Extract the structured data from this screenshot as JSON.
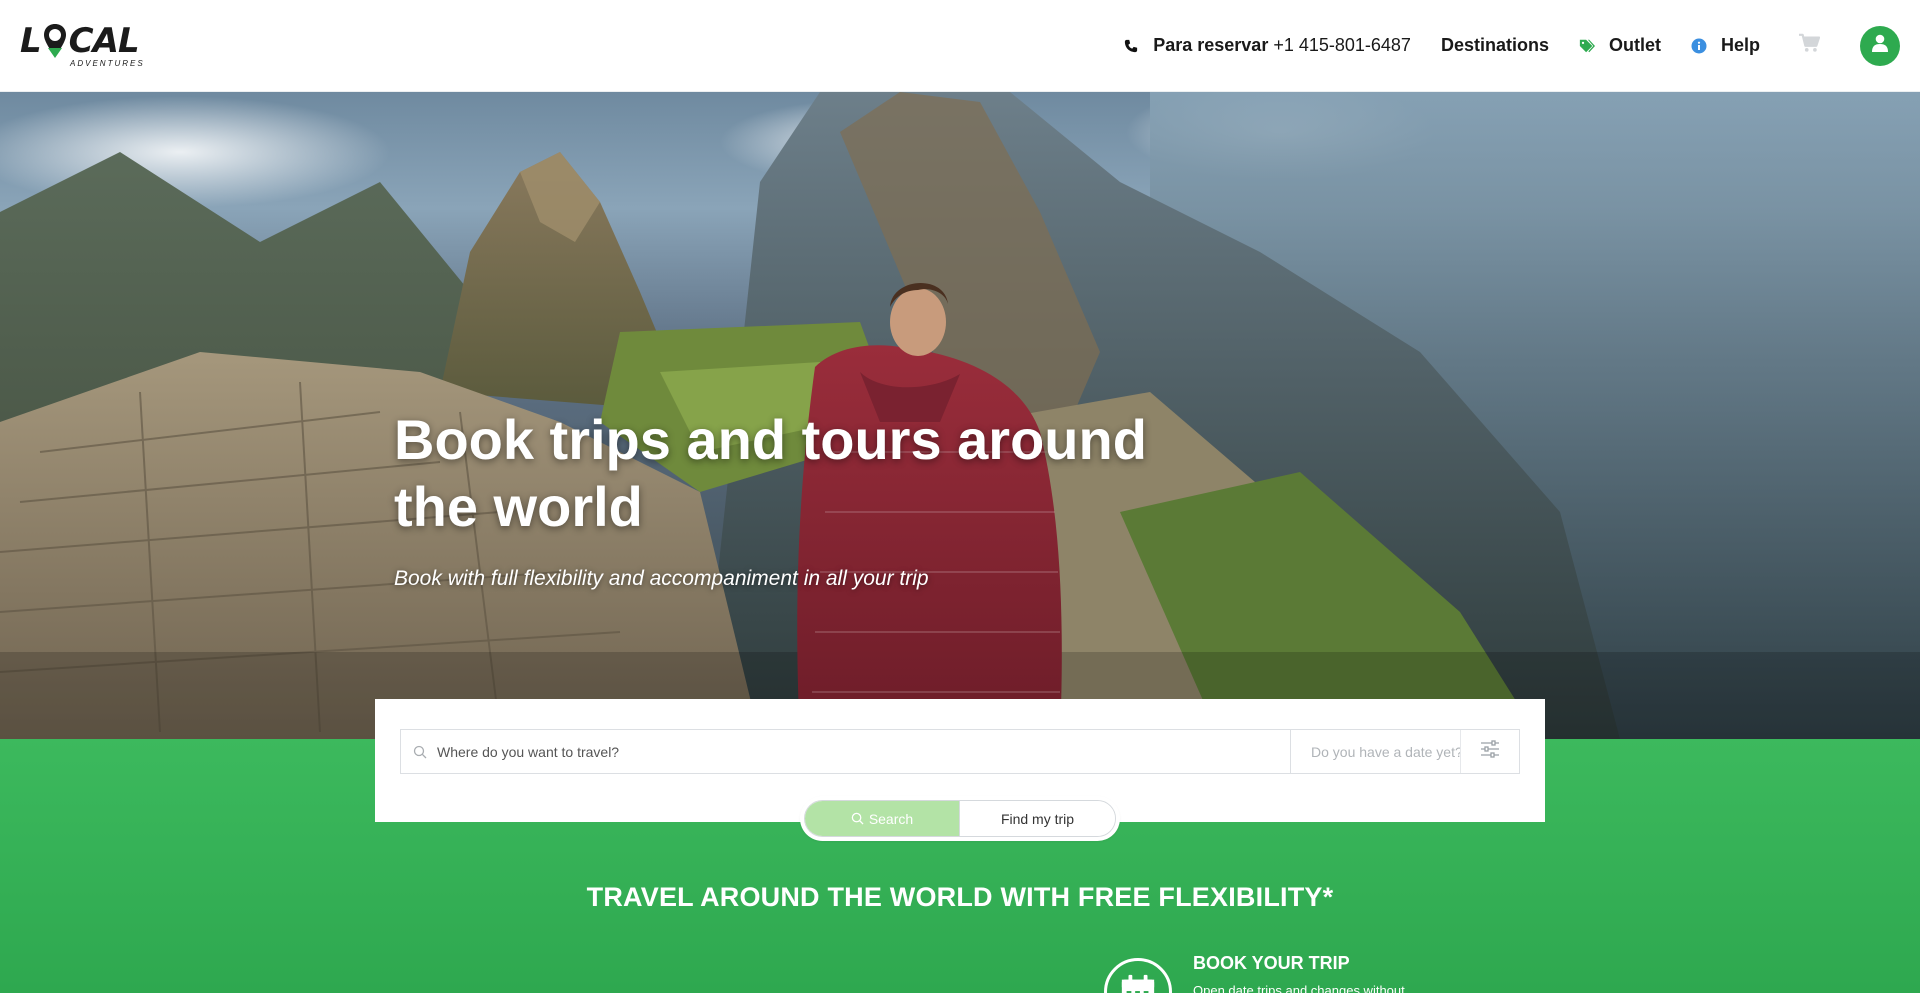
{
  "brand": {
    "logo_main_left": "L",
    "logo_main_right": "CAL",
    "logo_sub": "ADVENTURES",
    "colors": {
      "primary_green": "#2eaa4f",
      "band_green": "#3cb95d",
      "help_blue": "#3b8fe0"
    }
  },
  "header": {
    "phone": {
      "icon": "phone-icon",
      "label": "Para reservar",
      "number": "+1 415-801-6487"
    },
    "nav": {
      "destinations": "Destinations",
      "outlet": {
        "label": "Outlet",
        "icon": "tag-icon"
      },
      "help": {
        "label": "Help",
        "icon": "info-icon"
      }
    },
    "cart_icon": "cart-icon",
    "user_icon": "user-icon"
  },
  "hero": {
    "title": "Book trips and tours around the world",
    "subtitle": "Book with full flexibility and accompaniment in all your trip"
  },
  "search": {
    "destination_placeholder": "Where do you want to travel?",
    "destination_value": "",
    "date_placeholder": "Do you have a date yet?",
    "date_value": "",
    "filter_icon": "sliders-icon",
    "search_button": "Search",
    "find_trip_button": "Find my trip"
  },
  "band": {
    "title": "TRAVEL AROUND THE WORLD WITH FREE FLEXIBILITY*",
    "feature": {
      "icon": "calendar-icon",
      "title": "BOOK YOUR TRIP",
      "description": "Open date trips and changes without"
    }
  }
}
